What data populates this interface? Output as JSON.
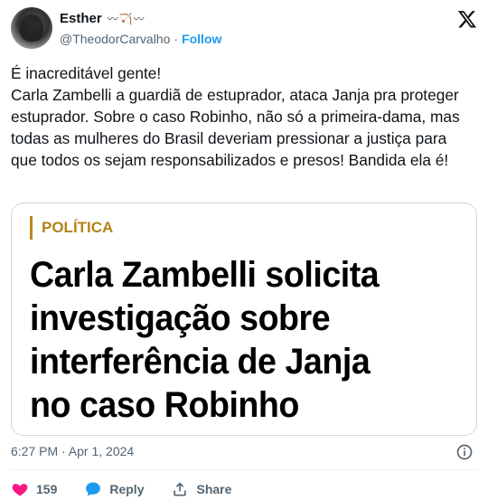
{
  "author": {
    "name": "Esther",
    "name_emoji": "〰🏹〰",
    "handle": "@TheodorCarvalho",
    "separator": "·",
    "follow_label": "Follow"
  },
  "tweet": {
    "text": "É inacreditável gente!\nCarla Zambelli a guardiã de estuprador, ataca Janja pra proteger estuprador. Sobre o caso Robinho, não só a primeira-dama, mas todas as mulheres do Brasil deveriam pressionar a justiça para que todos os sejam responsabilizados e presos!  Bandida ela é!"
  },
  "card": {
    "section": "POLÍTICA",
    "headline": "Carla Zambelli solicita\ninvestigação sobre\ninterferência de Janja\nno caso Robinho"
  },
  "meta": {
    "timestamp": "6:27 PM · Apr 1, 2024"
  },
  "actions": {
    "like_count": "159",
    "reply_label": "Reply",
    "share_label": "Share"
  },
  "colors": {
    "like": "#f91880",
    "reply": "#1d9bf0",
    "follow": "#1d9bf0",
    "section_accent": "#b38318"
  }
}
